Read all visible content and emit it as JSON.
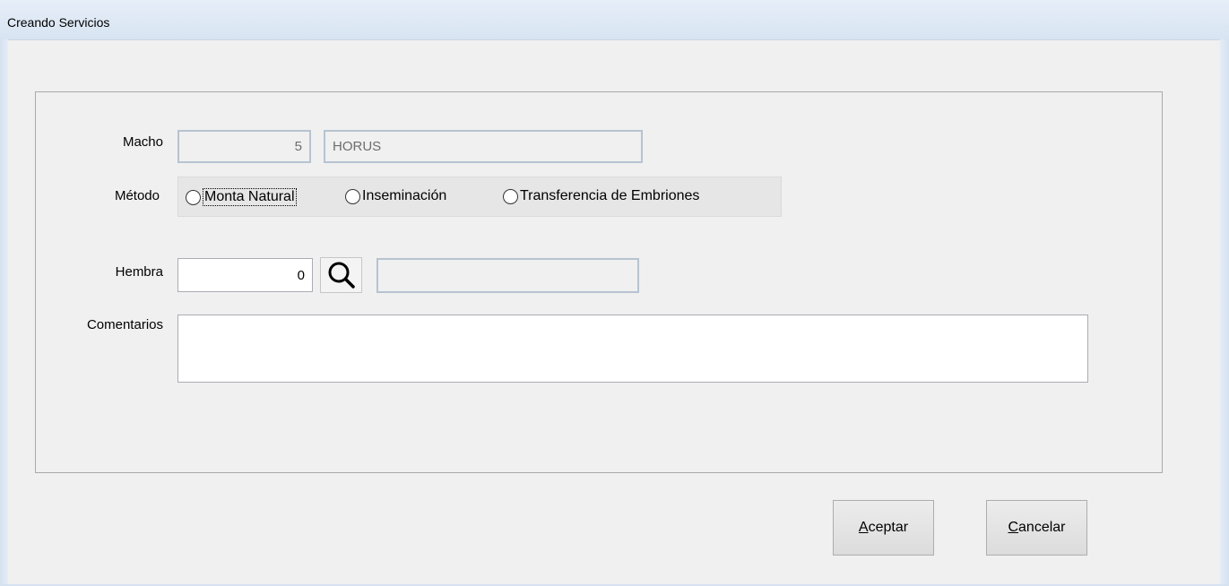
{
  "window": {
    "title": "Creando Servicios"
  },
  "form": {
    "macho": {
      "label": "Macho",
      "id_value": "5",
      "name_value": "HORUS"
    },
    "metodo": {
      "label": "Método",
      "options": [
        "Monta Natural",
        "Inseminación",
        "Transferencia de Embriones"
      ],
      "selected": null
    },
    "hembra": {
      "label": "Hembra",
      "id_value": "0",
      "name_value": "",
      "search_icon": "search-icon"
    },
    "comentarios": {
      "label": "Comentarios",
      "value": ""
    }
  },
  "buttons": {
    "accept": {
      "mnemonic": "A",
      "rest": "ceptar"
    },
    "cancel": {
      "mnemonic": "C",
      "rest": "ancelar"
    }
  }
}
